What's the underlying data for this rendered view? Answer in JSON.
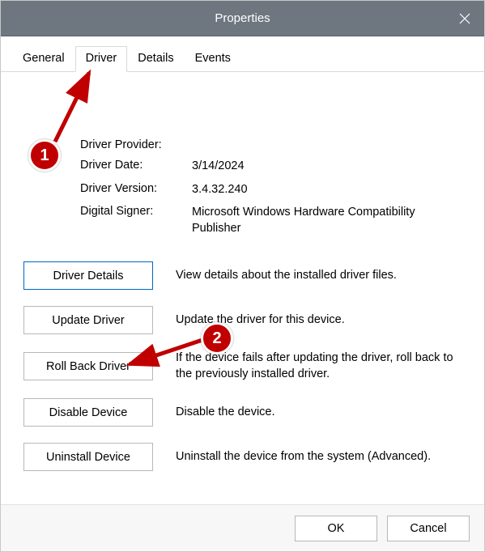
{
  "window": {
    "title": "Properties"
  },
  "tabs": {
    "general": "General",
    "driver": "Driver",
    "details": "Details",
    "events": "Events",
    "active": "Driver"
  },
  "info": {
    "provider": {
      "label": "Driver Provider:",
      "value": ""
    },
    "date": {
      "label": "Driver Date:",
      "value": "3/14/2024"
    },
    "version": {
      "label": "Driver Version:",
      "value": "3.4.32.240"
    },
    "signer": {
      "label": "Digital Signer:",
      "value": "Microsoft Windows Hardware Compatibility Publisher"
    }
  },
  "actions": {
    "details": {
      "button": "Driver Details",
      "desc": "View details about the installed driver files."
    },
    "update": {
      "button": "Update Driver",
      "desc": "Update the driver for this device."
    },
    "rollback": {
      "button": "Roll Back Driver",
      "desc": "If the device fails after updating the driver, roll back to the previously installed driver."
    },
    "disable": {
      "button": "Disable Device",
      "desc": "Disable the device."
    },
    "uninstall": {
      "button": "Uninstall Device",
      "desc": "Uninstall the device from the system (Advanced)."
    }
  },
  "footer": {
    "ok": "OK",
    "cancel": "Cancel"
  },
  "annotations": {
    "1": "1",
    "2": "2"
  }
}
